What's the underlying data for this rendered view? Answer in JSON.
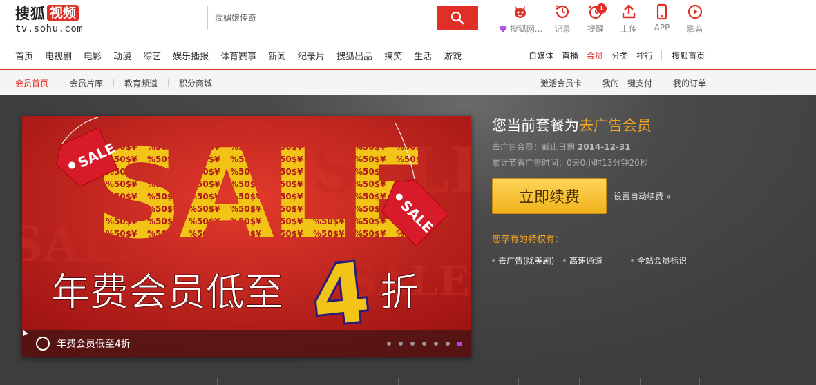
{
  "logo": {
    "cn": "搜狐",
    "badge": "视频",
    "domain": "tv.sohu.com"
  },
  "search": {
    "placeholder": "武媚娘传奇",
    "button_icon": "search-icon"
  },
  "tools": [
    {
      "label": "搜狐网...",
      "icon": "mascot-icon"
    },
    {
      "label": "记录",
      "icon": "history-icon"
    },
    {
      "label": "提醒",
      "icon": "alarm-icon",
      "badge": "1"
    },
    {
      "label": "上传",
      "icon": "upload-icon"
    },
    {
      "label": "APP",
      "icon": "phone-icon"
    },
    {
      "label": "影音",
      "icon": "play-icon"
    }
  ],
  "nav": {
    "left": [
      "首页",
      "电视剧",
      "电影",
      "动漫",
      "综艺",
      "娱乐播报",
      "体育赛事",
      "新闻",
      "纪录片",
      "搜狐出品",
      "搞笑",
      "生活",
      "游戏"
    ],
    "right": [
      "自媒体",
      "直播",
      "会员",
      "分类",
      "排行"
    ],
    "home": "搜狐首页"
  },
  "subnav": {
    "left": [
      "会员首页",
      "会员片库",
      "教育频道",
      "积分商城"
    ],
    "right": [
      "激活会员卡",
      "我的一键支付",
      "我的订单"
    ]
  },
  "banner": {
    "headline": "年费会员低至",
    "number": "4",
    "suffix": "折",
    "caption": "年费会员低至4折",
    "big_word": "SALE",
    "tag_text": "SALE",
    "dots": 7
  },
  "plan": {
    "title_prefix": "您当前套餐为",
    "title_highlight": "去广告会员",
    "expiry_label": "去广告会员：截止日期",
    "expiry_date": "2014-12-31",
    "saved_time": "累计节省广告时间：0天0小时13分钟20秒",
    "renew": "立即续费",
    "auto_renew": "设置自动续费 »",
    "privileges_title": "您享有的特权有：",
    "privileges": [
      "去广告(除美剧)",
      "高速通道",
      "全站会员标识"
    ]
  },
  "colors": {
    "brand_red": "#e02f26",
    "gold": "#f5a623",
    "dark_bg": "#3d3d3d"
  }
}
